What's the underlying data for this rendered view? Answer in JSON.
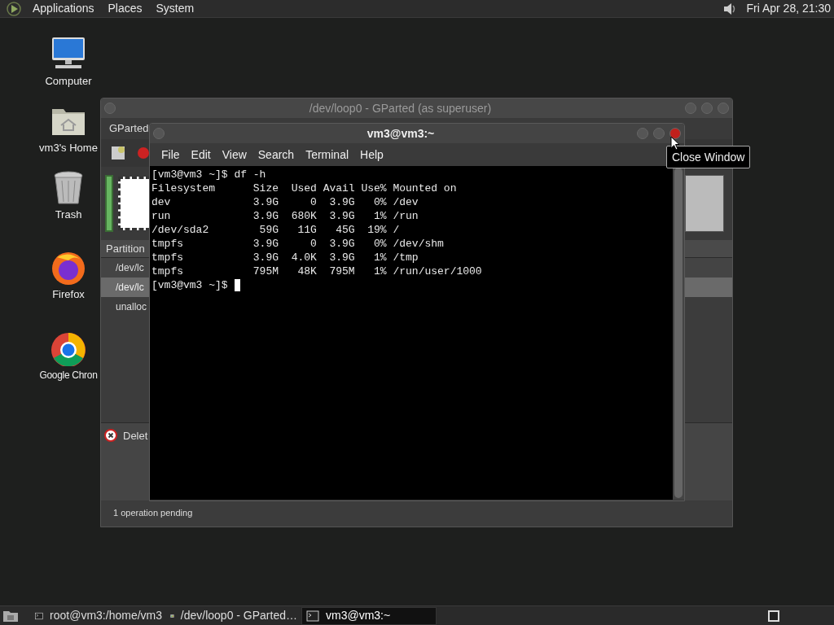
{
  "top_panel": {
    "menus": [
      "Applications",
      "Places",
      "System"
    ],
    "clock": "Fri Apr 28, 21:30"
  },
  "desktop_icons": [
    {
      "label": "Computer",
      "kind": "computer"
    },
    {
      "label": "vm3's Home",
      "kind": "home"
    },
    {
      "label": "Trash",
      "kind": "trash"
    },
    {
      "label": "Firefox",
      "kind": "firefox"
    },
    {
      "label": "Google Chron",
      "kind": "chrome"
    }
  ],
  "gparted": {
    "title": "/dev/loop0 - GParted (as superuser)",
    "menu": "GParted",
    "column_header": "Partition",
    "rows": [
      {
        "text": "/dev/lc",
        "selected": false
      },
      {
        "text": "/dev/lc",
        "selected": true
      },
      {
        "text": "unalloc",
        "selected": false
      }
    ],
    "operation": "Delet",
    "status": "1 operation pending"
  },
  "terminal": {
    "title": "vm3@vm3:~",
    "menus": [
      "File",
      "Edit",
      "View",
      "Search",
      "Terminal",
      "Help"
    ],
    "lines": [
      "[vm3@vm3 ~]$ df -h",
      "Filesystem      Size  Used Avail Use% Mounted on",
      "dev             3.9G     0  3.9G   0% /dev",
      "run             3.9G  680K  3.9G   1% /run",
      "/dev/sda2        59G   11G   45G  19% /",
      "tmpfs           3.9G     0  3.9G   0% /dev/shm",
      "tmpfs           3.9G  4.0K  3.9G   1% /tmp",
      "tmpfs           795M   48K  795M   1% /run/user/1000"
    ],
    "prompt": "[vm3@vm3 ~]$"
  },
  "tooltip": "Close Window",
  "taskbar": [
    {
      "label": "root@vm3:/home/vm3",
      "kind": "terminal",
      "selected": false
    },
    {
      "label": "/dev/loop0 - GParted…",
      "kind": "gparted",
      "selected": false
    },
    {
      "label": "vm3@vm3:~",
      "kind": "terminal",
      "selected": true
    }
  ]
}
